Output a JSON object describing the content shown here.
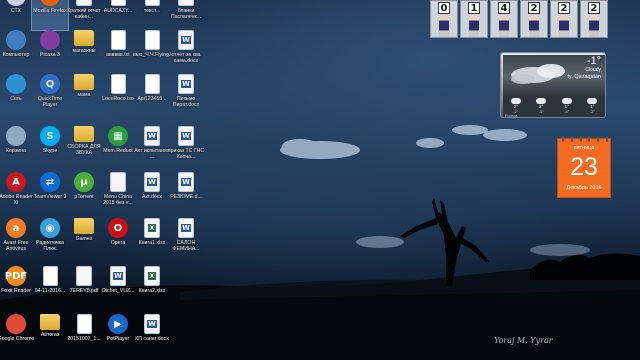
{
  "desktop": {
    "icons": [
      {
        "name": "ctx-icon",
        "label": "СТХ",
        "glyph": "",
        "kind": "app",
        "color": "#c8d3e0"
      },
      {
        "name": "mozilla-firefox-icon",
        "label": "Mozilla Firefox",
        "glyph": "",
        "kind": "app",
        "color": "#e66000"
      },
      {
        "name": "report-icon",
        "label": "Краткий отчет кабин...",
        "glyph": "",
        "kind": "word"
      },
      {
        "name": "audio-file-icon",
        "label": "AUDCAZY...",
        "glyph": "",
        "kind": "txt"
      },
      {
        "name": "text-file-icon",
        "label": "текст...",
        "glyph": "",
        "kind": "txt"
      },
      {
        "name": "word-doc-icon",
        "label": "бланки Паспаленк...",
        "glyph": "",
        "kind": "word"
      },
      {
        "name": "computer-icon",
        "label": "Компьютер",
        "glyph": "",
        "kind": "app",
        "color": "#3f7fbf"
      },
      {
        "name": "picasa-icon",
        "label": "Picasa 3",
        "glyph": "",
        "kind": "app",
        "color": "#7e3fa0"
      },
      {
        "name": "shops-folder-icon",
        "label": "магазины",
        "glyph": "",
        "kind": "folder"
      },
      {
        "name": "text-file-icon",
        "label": "вввввв.txt",
        "glyph": "",
        "kind": "txt"
      },
      {
        "name": "text-file-icon",
        "label": "вью_Ч.Ч.Flying.txt",
        "glyph": "",
        "kind": "txt"
      },
      {
        "name": "word-doc-icon",
        "label": "отчёт за ква сама.docx",
        "glyph": "",
        "kind": "word"
      },
      {
        "name": "network-icon",
        "label": "Сеть",
        "glyph": "",
        "kind": "app",
        "color": "#2d8fd6"
      },
      {
        "name": "quicktime-icon",
        "label": "QuickTime Player",
        "glyph": "Q",
        "kind": "app",
        "color": "#2f6ec7"
      },
      {
        "name": "folder-icon",
        "label": "мама",
        "glyph": "",
        "kind": "folder"
      },
      {
        "name": "text-file-icon",
        "label": "LocoRoco.iso",
        "glyph": "",
        "kind": "txt"
      },
      {
        "name": "image-file-icon",
        "label": "Api123456...",
        "glyph": "",
        "kind": "txt"
      },
      {
        "name": "word-doc-icon",
        "label": "Письмо Пират.docx",
        "glyph": "",
        "kind": "word"
      },
      {
        "name": "recycle-bin-icon",
        "label": "Корзина",
        "glyph": "",
        "kind": "app",
        "color": "#8faac4"
      },
      {
        "name": "skype-icon",
        "label": "Skype",
        "glyph": "S",
        "kind": "app",
        "color": "#00aff0"
      },
      {
        "name": "folder-icon",
        "label": "СБОРКА ДЛЯ ЗВУКА",
        "glyph": "",
        "kind": "folder"
      },
      {
        "name": "mem-reduct-icon",
        "label": "Mem Reduct",
        "glyph": "▦",
        "kind": "app",
        "color": "#2e9b3e"
      },
      {
        "name": "word-doc-icon",
        "label": "Акт испытания ...",
        "glyph": "",
        "kind": "word"
      },
      {
        "name": "word-doc-icon",
        "label": "приказ ТС ГНС Капча...",
        "glyph": "",
        "kind": "word"
      },
      {
        "name": "adobe-reader-icon",
        "label": "Adobe Reader XI",
        "glyph": "A",
        "kind": "app",
        "color": "#c4161c"
      },
      {
        "name": "teamviewer-icon",
        "label": "TeamViewer 9",
        "glyph": "⇄",
        "kind": "app",
        "color": "#0e6ad6"
      },
      {
        "name": "utorrent-icon",
        "label": "µTorrent",
        "glyph": "µ",
        "kind": "app",
        "color": "#4cae3a"
      },
      {
        "name": "pdf-file-icon",
        "label": "Menu China 2015 без н...",
        "glyph": "",
        "kind": "pdf"
      },
      {
        "name": "word-doc-icon",
        "label": "Акт.docx",
        "glyph": "",
        "kind": "word"
      },
      {
        "name": "word-doc-icon",
        "label": "РЕЗЮМЕ.d...",
        "glyph": "",
        "kind": "word"
      },
      {
        "name": "avast-icon",
        "label": "Avast Free Antivirus",
        "glyph": "a",
        "kind": "app",
        "color": "#f47c20"
      },
      {
        "name": "radio-icon",
        "label": "Радиоточка Плюс",
        "glyph": "◉",
        "kind": "app",
        "color": "#3aa0d8"
      },
      {
        "name": "games-folder-icon",
        "label": "Games",
        "glyph": "",
        "kind": "folder"
      },
      {
        "name": "opera-icon",
        "label": "Opera",
        "glyph": "O",
        "kind": "app",
        "color": "#cc0f16"
      },
      {
        "name": "excel-file-icon",
        "label": "Книга1.xlsx",
        "glyph": "",
        "kind": "excel"
      },
      {
        "name": "word-doc-icon",
        "label": "САЛОН ФЕМИНА...",
        "glyph": "",
        "kind": "word"
      },
      {
        "name": "foxit-reader-icon",
        "label": "Foxit Reader",
        "glyph": "PDF",
        "kind": "app",
        "color": "#f28a20"
      },
      {
        "name": "media-file-icon",
        "label": "04-11-2016...",
        "glyph": "",
        "kind": "txt"
      },
      {
        "name": "pdf-file-icon",
        "label": "7EREV8.pdf",
        "glyph": "",
        "kind": "pdf"
      },
      {
        "name": "word-doc-icon",
        "label": "Otchet_VUZ...",
        "glyph": "",
        "kind": "word"
      },
      {
        "name": "excel-file-icon",
        "label": "Книга2.xlsx",
        "glyph": "",
        "kind": "excel"
      },
      {
        "name": "chrome-icon",
        "label": "Google Chrome",
        "glyph": "",
        "kind": "app",
        "color": "#dd4b39"
      },
      {
        "name": "autogas-folder-icon",
        "label": "Автогаз",
        "glyph": "",
        "kind": "folder"
      },
      {
        "name": "text-file-icon",
        "label": "20151007_1...",
        "glyph": "",
        "kind": "txt"
      },
      {
        "name": "potplayer-icon",
        "label": "PotPlayer",
        "glyph": "▶",
        "kind": "app",
        "color": "#1b66c9"
      },
      {
        "name": "word-doc-icon",
        "label": "КП санат.docx",
        "glyph": "",
        "kind": "word"
      }
    ]
  },
  "stocks_gadget": {
    "tiles": [
      "0",
      "1",
      "4",
      "2",
      "2",
      "2"
    ]
  },
  "weather_gadget": {
    "temperature": "-1°",
    "condition": "Cloudy",
    "city": "ty, Qazaqstan",
    "forecast": [
      {
        "temp": "2°",
        "low": "-2°"
      },
      {
        "temp": "2°",
        "low": "-3°"
      },
      {
        "temp": "1°",
        "low": "-4°"
      },
      {
        "temp": "1°",
        "low": "-2°"
      }
    ],
    "footer": "Foreca"
  },
  "calendar_gadget": {
    "weekday": "пятница",
    "day": "23",
    "month_year": "Декабрь 2016"
  },
  "signature": "Yoraj M. Yyrar"
}
